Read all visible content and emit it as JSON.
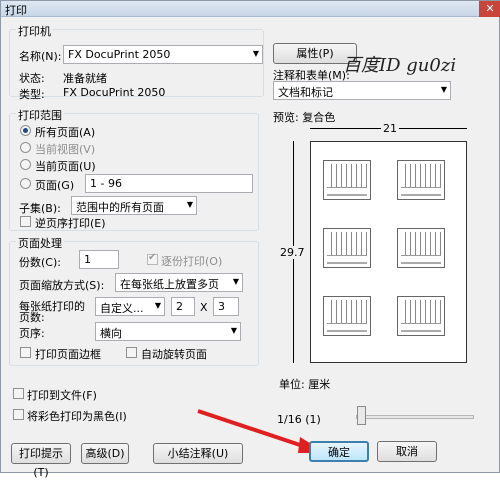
{
  "window": {
    "title": "打印",
    "close": "✕"
  },
  "printer": {
    "group": "打印机",
    "name_label": "名称(N):",
    "name_value": "FX DocuPrint 2050",
    "props_button": "属性(P)",
    "status_label": "状态:",
    "status_value": "准备就绪",
    "type_label": "类型:",
    "type_value": "FX DocuPrint 2050",
    "comments_label": "注释和表单(M):",
    "comments_value": "文档和标记"
  },
  "watermark": "百度ID gu0zi",
  "range": {
    "group": "打印范围",
    "all": "所有页面(A)",
    "current_view": "当前视图(V)",
    "current_page": "当前页面(U)",
    "pages": "页面(G)",
    "pages_value": "1 - 96",
    "subset_label": "子集(B):",
    "subset_value": "范围中的所有页面",
    "reverse": "逆页序打印(E)"
  },
  "handling": {
    "group": "页面处理",
    "copies_label": "份数(C):",
    "copies_value": "1",
    "collate": "逐份打印(O)",
    "scaling_label": "页面缩放方式(S):",
    "scaling_value": "在每张纸上放置多页",
    "pps_label": "每张纸打印的页数:",
    "pps_value": "自定义...",
    "cols": "2",
    "x": "X",
    "rows": "3",
    "order_label": "页序:",
    "order_value": "横向",
    "border": "打印页面边框",
    "autorotate": "自动旋转页面"
  },
  "options": {
    "print_to_file": "打印到文件(F)",
    "black": "将彩色打印为黑色(I)"
  },
  "preview": {
    "label": "预览: 复合色",
    "width": "21",
    "height": "29.7",
    "unit": "单位: 厘米",
    "page": "1/16 (1)"
  },
  "buttons": {
    "tips": "打印提示(T)",
    "advanced": "高级(D)",
    "summarize": "小结注释(U)",
    "ok": "确定",
    "cancel": "取消"
  },
  "colors": {
    "arrow": "#e02020",
    "accent": "#3c7fb1"
  }
}
